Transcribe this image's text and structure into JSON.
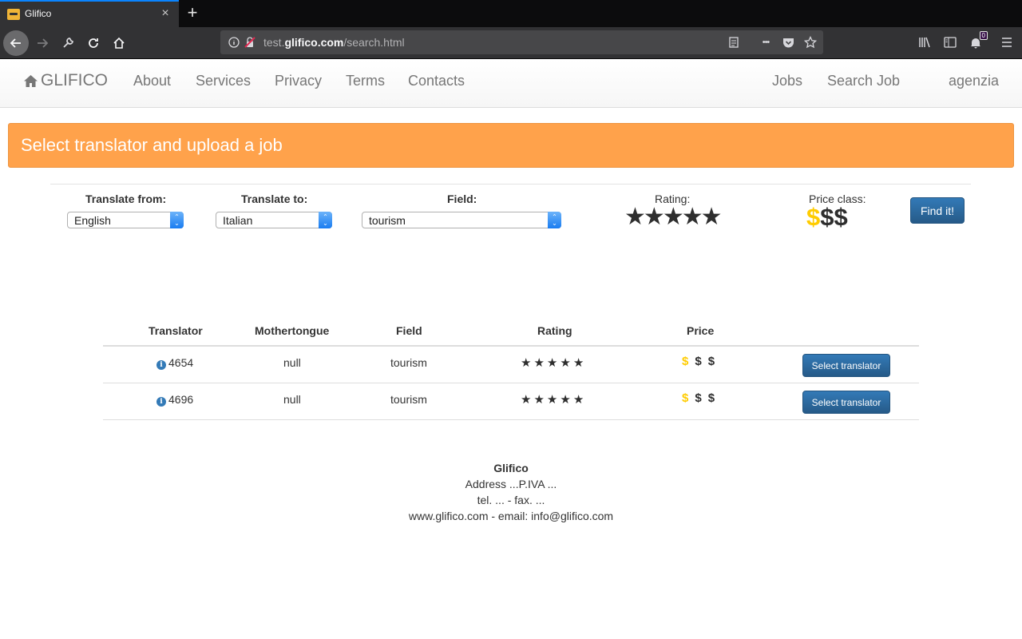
{
  "browser": {
    "tab_title": "Glifico",
    "tab_close": "×",
    "new_tab": "+",
    "url_prefix": "test.",
    "url_domain": "glifico.com",
    "url_path": "/search.html",
    "notification_count": "0",
    "more_menu": "•••"
  },
  "site_nav": {
    "brand": "GLIFICO",
    "links": [
      "About",
      "Services",
      "Privacy",
      "Terms",
      "Contacts"
    ],
    "right_links": [
      "Jobs",
      "Search Job",
      "agenzia"
    ]
  },
  "banner": {
    "title": "Select translator and upload a job"
  },
  "search": {
    "translate_from_label": "Translate from:",
    "translate_from_value": "English",
    "translate_to_label": "Translate to:",
    "translate_to_value": "Italian",
    "field_label": "Field:",
    "field_value": "tourism",
    "rating_label": "Rating:",
    "rating_value": 5,
    "price_class_label": "Price class:",
    "price_class_symbol": "$",
    "price_class_selected": 1,
    "find_button": "Find it!"
  },
  "results": {
    "headers": [
      "Translator",
      "Mothertongue",
      "Field",
      "Rating",
      "Price"
    ],
    "rows": [
      {
        "translator": "4654",
        "mothertongue": "null",
        "field": "tourism",
        "rating": 5,
        "price_selected": 1,
        "action": "Select translator"
      },
      {
        "translator": "4696",
        "mothertongue": "null",
        "field": "tourism",
        "rating": 5,
        "price_selected": 1,
        "action": "Select translator"
      }
    ]
  },
  "footer": {
    "name": "Glifico",
    "address": "Address ...P.IVA ...",
    "phone": "tel. ... - fax. ...",
    "contact": "www.glifico.com - email: info@glifico.com"
  },
  "colors": {
    "banner": "#ffa24b",
    "price_active": "#ffcc00",
    "button": "#337ab7",
    "browser_accent": "#0a84ff"
  }
}
